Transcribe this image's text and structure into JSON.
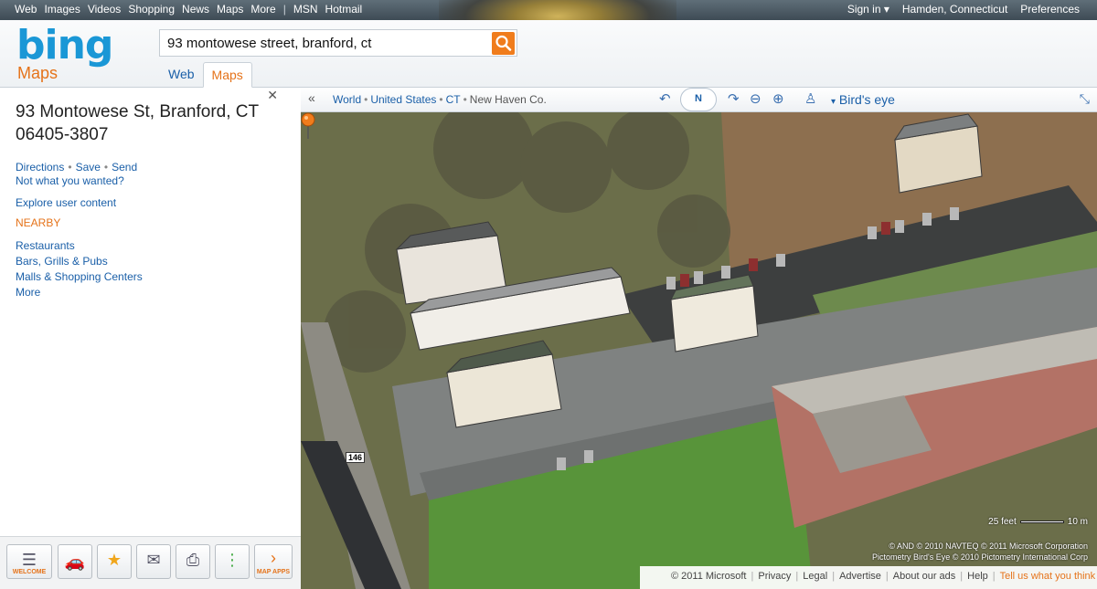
{
  "topnav": {
    "links": [
      "Web",
      "Images",
      "Videos",
      "Shopping",
      "News",
      "Maps",
      "More"
    ],
    "separator": "|",
    "extra": [
      "MSN",
      "Hotmail"
    ],
    "sign_in": "Sign in ▾",
    "location": "Hamden, Connecticut",
    "preferences": "Preferences"
  },
  "header": {
    "logo": "bing",
    "product": "Maps",
    "search_value": "93 montowese street, branford, ct",
    "tabs": [
      "Web",
      "Maps"
    ],
    "active_tab": "Maps"
  },
  "panel": {
    "address_line1": "93 Montowese St, Branford, CT",
    "address_line2": "06405-3807",
    "actions": [
      "Directions",
      "Save",
      "Send"
    ],
    "not_wanted": "Not what you wanted?",
    "explore": "Explore user content",
    "nearby_title": "NEARBY",
    "nearby": [
      "Restaurants",
      "Bars, Grills & Pubs",
      "Malls & Shopping Centers",
      "More"
    ]
  },
  "toolbar": {
    "welcome": "WELCOME",
    "map_apps": "MAP APPS"
  },
  "map_toolbar": {
    "breadcrumbs": [
      "World",
      "United States",
      "CT"
    ],
    "current": "New Haven Co.",
    "compass_label": "N",
    "view": "Bird's eye"
  },
  "map": {
    "route_shield": "146",
    "scale_feet": "25 feet",
    "scale_m": "10 m",
    "copyright_line1": "© AND  © 2010 NAVTEQ  © 2011 Microsoft Corporation",
    "copyright_line2": "Pictometry Bird's Eye © 2010 Pictometry International Corp"
  },
  "footer": {
    "items": [
      "© 2011 Microsoft",
      "Privacy",
      "Legal",
      "Advertise",
      "About our ads",
      "Help"
    ],
    "tell": "Tell us what you think"
  },
  "colors": {
    "brand_blue": "#1a97d6",
    "accent_orange": "#e5731a",
    "link_blue": "#1a5fa8"
  }
}
